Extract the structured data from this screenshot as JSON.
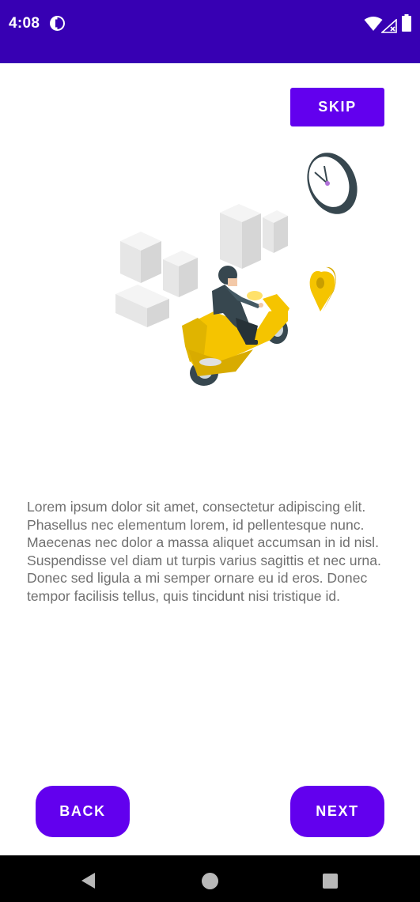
{
  "status_bar": {
    "time": "4:08",
    "notification_icon": "data-saver-icon",
    "wifi_icon": "wifi-icon",
    "signal_icon": "no-signal-icon",
    "battery_icon": "battery-icon",
    "background": "#3700b3"
  },
  "onboarding": {
    "skip_label": "SKIP",
    "illustration": "delivery-scooter-illustration",
    "description": "Lorem ipsum dolor sit amet, consectetur adipiscing elit. Phasellus nec elementum lorem, id pellentesque nunc. Maecenas nec dolor a massa aliquet accumsan in id nisl. Suspendisse vel diam ut turpis varius sagittis et nec urna. Donec sed ligula a mi semper ornare eu id eros. Donec tempor facilisis tellus, quis tincidunt nisi tristique id.",
    "back_label": "BACK",
    "next_label": "NEXT",
    "accent": "#6200ee"
  },
  "nav_bar": {
    "back_icon": "triangle-back-icon",
    "home_icon": "circle-home-icon",
    "recents_icon": "square-recents-icon"
  }
}
